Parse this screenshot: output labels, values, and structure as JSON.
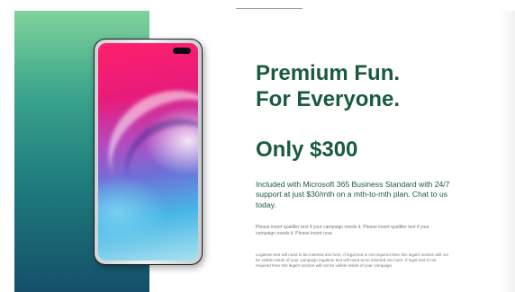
{
  "banner": {
    "headline_line1": "Premium Fun.",
    "headline_line2": "For Everyone.",
    "price": "Only $300",
    "body": "Included with Microsoft 365 Business Standard with 24/7 support at just $30/mth on a mth-to-mth plan. Chat to us today.",
    "qualifier": "Please insert qualifier text if your campaign needs it. Please insert qualifier text if your campaign needs it. Please insert now.",
    "legalese": "Legalese text will need to be inserted into here. If legal text is not required then this legal's section will not be visible inside of your campaign legalese text will need to be inserted into here. If legal text is not required then this legal's section will not be visible inside of your campaign.",
    "colors": {
      "headline": "#1a5a3e",
      "panel_top": "#7fd39a",
      "panel_bottom": "#14506a"
    }
  }
}
